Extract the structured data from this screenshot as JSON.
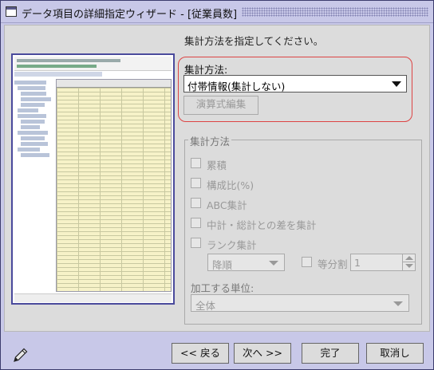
{
  "window": {
    "title": "データ項目の詳細指定ウィザード - [従業員数]"
  },
  "instruction": "集計方法を指定してください。",
  "aggregation": {
    "label": "集計方法:",
    "selected": "付帯情報(集計しない)",
    "expression_button": "演算式編集"
  },
  "method_group": {
    "title": "集計方法",
    "options": [
      {
        "label": "累積",
        "checked": false
      },
      {
        "label": "構成比(%)",
        "checked": false
      },
      {
        "label": "ABC集計",
        "checked": false
      },
      {
        "label": "中計・総計との差を集計",
        "checked": false
      },
      {
        "label": "ランク集計",
        "checked": false
      }
    ],
    "rank_order": "降順",
    "equal_division_label": "等分割",
    "equal_division_value": "1",
    "unit_label": "加工する単位:",
    "unit_value": "全体"
  },
  "buttons": {
    "back": "<< 戻る",
    "next": "次へ >>",
    "finish": "完了",
    "cancel": "取消し"
  },
  "icons": {
    "window": "window-icon",
    "pencil": "pencil-icon"
  },
  "colors": {
    "window_frame": "#c8c8e8",
    "highlight": "#d44444",
    "preview_border": "#4a4a9c"
  }
}
